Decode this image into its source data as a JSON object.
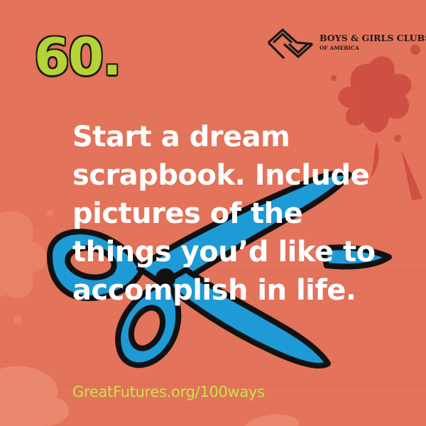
{
  "number": "60.",
  "logo": {
    "line1": "BOYS & GIRLS CLUBS",
    "line2": "OF AMERICA",
    "icon": "bgca-hands-logo-icon"
  },
  "message": {
    "lines": [
      "Start a dream",
      "scrapbook. Include",
      "pictures of the",
      "things you’d like to",
      "accomplish in life."
    ]
  },
  "footer": {
    "link": "GreatFutures.org/100ways"
  },
  "illustration": {
    "icon": "scissors-icon",
    "fill_color": "#1e9ad6",
    "outline_color": "#111111"
  },
  "colors": {
    "background": "#e3735a",
    "number": "#b5d334",
    "text": "#ffffff",
    "link": "#c9e34a"
  }
}
